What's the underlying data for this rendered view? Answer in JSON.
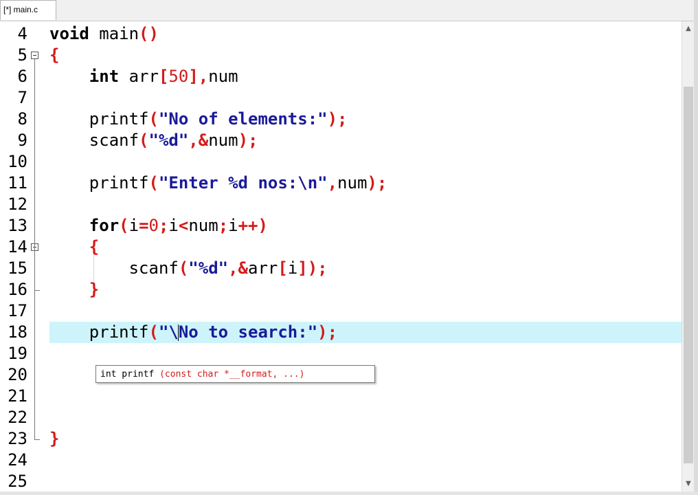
{
  "tab": {
    "label": "[*] main.c"
  },
  "lines": [
    {
      "n": "4",
      "segs": [
        [
          "kw",
          "void"
        ],
        [
          "t",
          " main"
        ],
        [
          "pun",
          "()"
        ]
      ]
    },
    {
      "n": "5",
      "segs": [
        [
          "pun",
          "{"
        ]
      ]
    },
    {
      "n": "6",
      "segs": [
        [
          "t",
          "    "
        ],
        [
          "kw",
          "int"
        ],
        [
          "t",
          " arr"
        ],
        [
          "pun",
          "["
        ],
        [
          "num",
          "50"
        ],
        [
          "pun",
          "],"
        ],
        [
          "t",
          "num"
        ]
      ]
    },
    {
      "n": "7",
      "segs": []
    },
    {
      "n": "8",
      "segs": [
        [
          "t",
          "    printf"
        ],
        [
          "pun",
          "("
        ],
        [
          "str",
          "\"No of elements:\""
        ],
        [
          "pun",
          ");"
        ]
      ]
    },
    {
      "n": "9",
      "segs": [
        [
          "t",
          "    scanf"
        ],
        [
          "pun",
          "("
        ],
        [
          "str",
          "\"%d\""
        ],
        [
          "pun",
          ",&"
        ],
        [
          "t",
          "num"
        ],
        [
          "pun",
          ");"
        ]
      ]
    },
    {
      "n": "10",
      "segs": []
    },
    {
      "n": "11",
      "segs": [
        [
          "t",
          "    printf"
        ],
        [
          "pun",
          "("
        ],
        [
          "str",
          "\"Enter %d nos:\\n\""
        ],
        [
          "pun",
          ","
        ],
        [
          "t",
          "num"
        ],
        [
          "pun",
          ");"
        ]
      ]
    },
    {
      "n": "12",
      "segs": []
    },
    {
      "n": "13",
      "segs": [
        [
          "t",
          "    "
        ],
        [
          "kw",
          "for"
        ],
        [
          "pun",
          "("
        ],
        [
          "t",
          "i"
        ],
        [
          "pun",
          "="
        ],
        [
          "num",
          "0"
        ],
        [
          "pun",
          ";"
        ],
        [
          "t",
          "i"
        ],
        [
          "pun",
          "<"
        ],
        [
          "t",
          "num"
        ],
        [
          "pun",
          ";"
        ],
        [
          "t",
          "i"
        ],
        [
          "pun",
          "++)"
        ]
      ]
    },
    {
      "n": "14",
      "segs": [
        [
          "t",
          "    "
        ],
        [
          "pun",
          "{"
        ]
      ]
    },
    {
      "n": "15",
      "segs": [
        [
          "t",
          "        scanf"
        ],
        [
          "pun",
          "("
        ],
        [
          "str",
          "\"%d\""
        ],
        [
          "pun",
          ",&"
        ],
        [
          "t",
          "arr"
        ],
        [
          "pun",
          "["
        ],
        [
          "t",
          "i"
        ],
        [
          "pun",
          "]);"
        ]
      ]
    },
    {
      "n": "16",
      "segs": [
        [
          "t",
          "    "
        ],
        [
          "pun",
          "}"
        ]
      ]
    },
    {
      "n": "17",
      "segs": []
    },
    {
      "n": "18",
      "segs": [
        [
          "t",
          "    printf"
        ],
        [
          "pun",
          "("
        ],
        [
          "str",
          "\"\\"
        ],
        [
          "caret",
          ""
        ],
        [
          "str",
          "No to search:\""
        ],
        [
          "pun",
          ");"
        ]
      ]
    },
    {
      "n": "19",
      "segs": []
    },
    {
      "n": "20",
      "segs": []
    },
    {
      "n": "21",
      "segs": []
    },
    {
      "n": "22",
      "segs": []
    },
    {
      "n": "23",
      "segs": [
        [
          "pun",
          "}"
        ]
      ]
    },
    {
      "n": "24",
      "segs": []
    },
    {
      "n": "25",
      "segs": []
    }
  ],
  "current_line": "18",
  "calltip": {
    "ret": "int printf",
    "params": "(const char *__format, ...)"
  },
  "scrollbar": {
    "up": "▲",
    "down": "▼"
  }
}
